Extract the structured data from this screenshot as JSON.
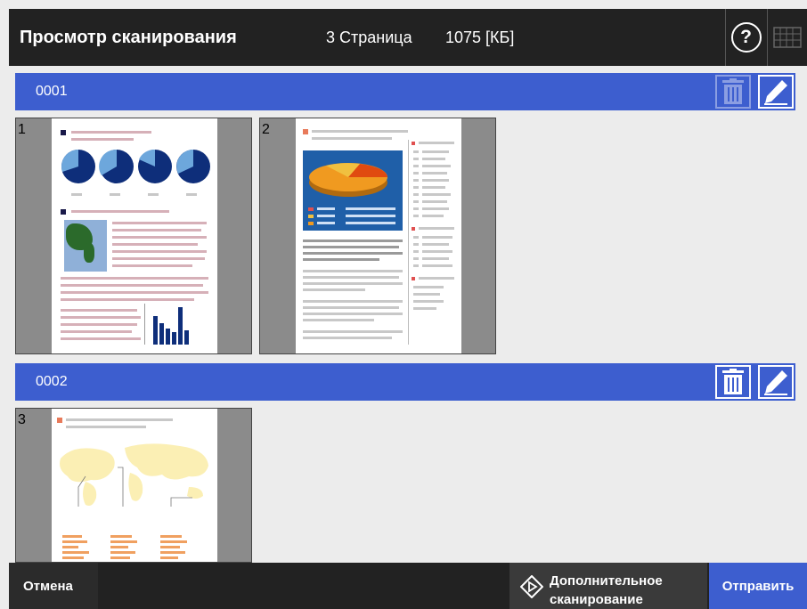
{
  "header": {
    "title": "Просмотр сканирования",
    "page_count": "3 Страница",
    "file_size": "1075 [КБ]",
    "help_icon": "help-icon",
    "keyboard_icon": "keyboard-icon"
  },
  "groups": [
    {
      "name": "0001",
      "pages": [
        {
          "number": "1"
        },
        {
          "number": "2"
        }
      ]
    },
    {
      "name": "0002",
      "pages": [
        {
          "number": "3"
        }
      ]
    }
  ],
  "footer": {
    "cancel_label": "Отмена",
    "extra_scan_label": "Дополнительное сканирование",
    "send_label": "Отправить"
  },
  "colors": {
    "header_bg": "#222222",
    "accent": "#3d5ecf",
    "content_bg": "#ececec"
  }
}
